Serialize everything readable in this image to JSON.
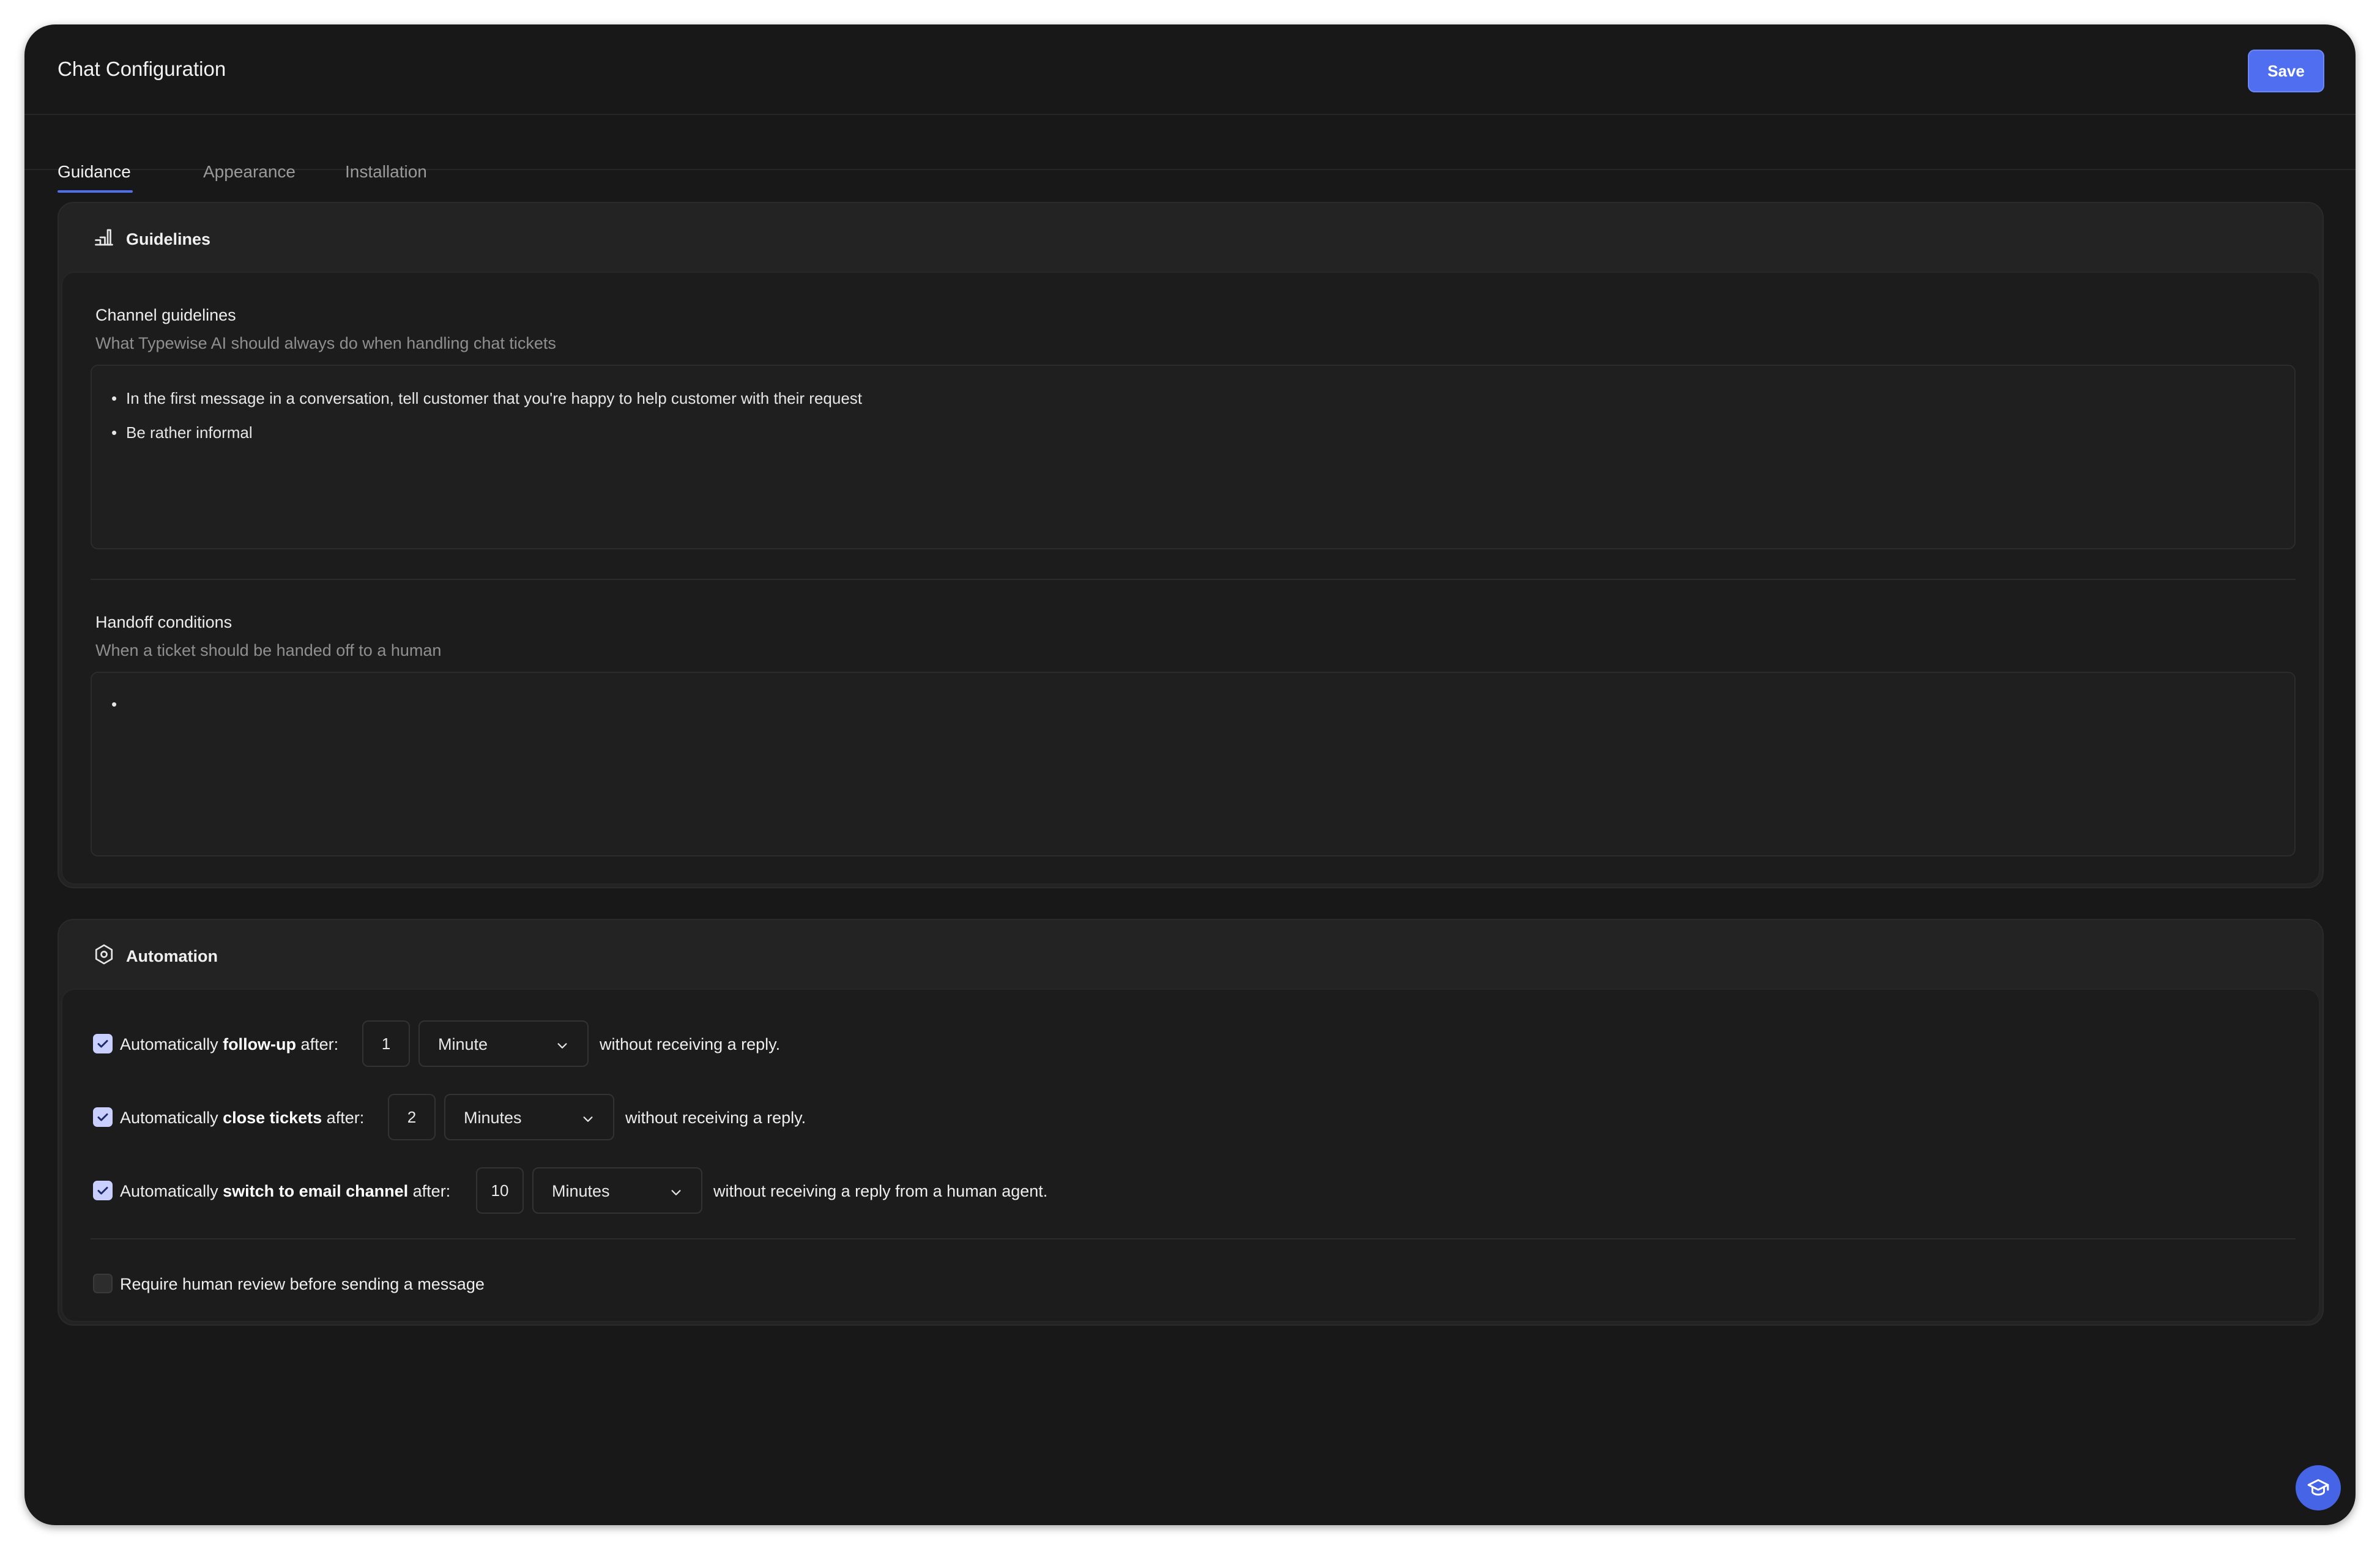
{
  "header": {
    "title": "Chat Configuration",
    "save_label": "Save"
  },
  "tabs": [
    {
      "label": "Guidance",
      "active": true
    },
    {
      "label": "Appearance",
      "active": false
    },
    {
      "label": "Installation",
      "active": false
    }
  ],
  "guidelines": {
    "title": "Guidelines",
    "icon": "stairs-icon",
    "channel": {
      "label": "Channel guidelines",
      "description": "What Typewise AI should always do when handling chat tickets",
      "items": [
        "In the first message in a conversation, tell customer that you're happy to help customer with their request",
        "Be rather informal"
      ]
    },
    "handoff": {
      "label": "Handoff conditions",
      "description": "When a ticket should be handed off to a human",
      "items": [
        ""
      ]
    }
  },
  "automation": {
    "title": "Automation",
    "icon": "hexagon-settings-icon",
    "rules": [
      {
        "checked": true,
        "prefix": "Automatically ",
        "bold": "follow-up",
        "suffix": " after:",
        "value": "1",
        "unit": "Minute",
        "tail": "without receiving a reply."
      },
      {
        "checked": true,
        "prefix": "Automatically ",
        "bold": "close tickets",
        "suffix": " after:",
        "value": "2",
        "unit": "Minutes",
        "tail": "without receiving a reply."
      },
      {
        "checked": true,
        "prefix": "Automatically ",
        "bold": "switch to email channel",
        "suffix": " after:",
        "value": "10",
        "unit": "Minutes",
        "tail": "without receiving a reply from a human agent."
      }
    ],
    "review": {
      "checked": false,
      "label": "Require human review before sending a message"
    }
  },
  "help_button": {
    "icon": "graduation-cap-icon"
  },
  "colors": {
    "accent": "#4f6ef0",
    "background": "#181818",
    "card": "#232323"
  }
}
